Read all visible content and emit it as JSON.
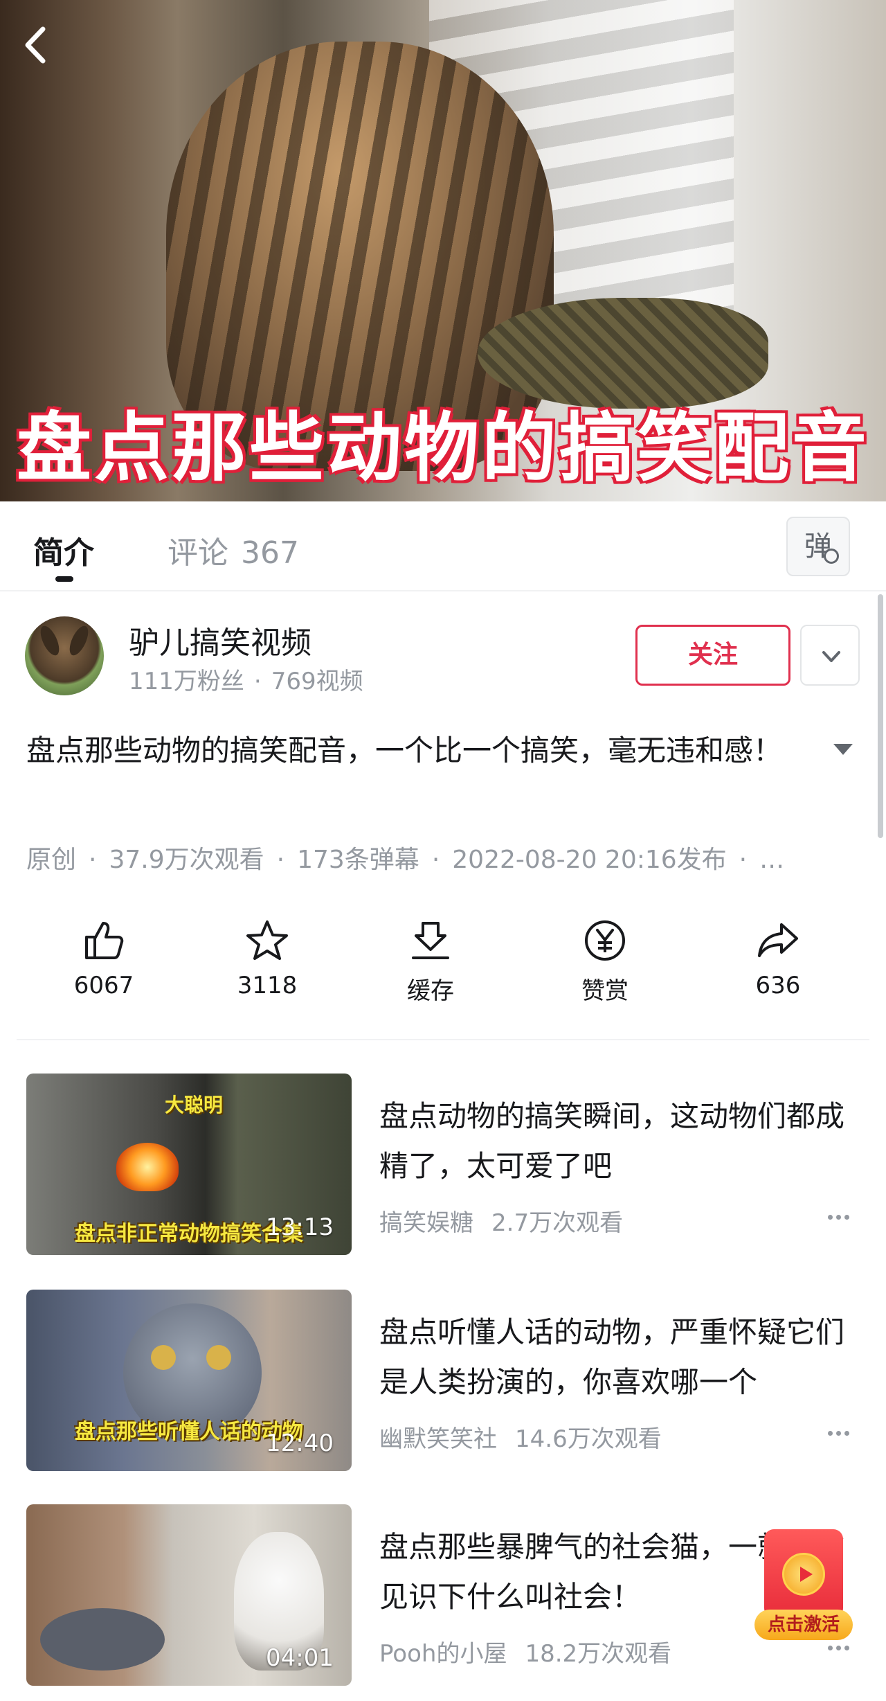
{
  "video": {
    "caption": "盘点那些动物的搞笑配音"
  },
  "tabs": {
    "intro": "简介",
    "comments_label": "评论",
    "comments_count": "367",
    "danmaku_toggle": "弹"
  },
  "uploader": {
    "name": "驴儿搞笑视频",
    "fans": "111万粉丝",
    "videos": "769视频",
    "follow_label": "关注"
  },
  "details": {
    "title": "盘点那些动物的搞笑配音，一个比一个搞笑，毫无违和感！",
    "meta": {
      "type": "原创",
      "views": "37.9万次观看",
      "danmaku": "173条弹幕",
      "published": "2022-08-20 20:16发布",
      "more": "…"
    }
  },
  "actions": [
    {
      "icon": "thumbs-up-icon",
      "label": "6067"
    },
    {
      "icon": "star-icon",
      "label": "3118"
    },
    {
      "icon": "download-icon",
      "label": "缓存"
    },
    {
      "icon": "yen-coin-icon",
      "label": "赞赏"
    },
    {
      "icon": "share-arrow-icon",
      "label": "636"
    }
  ],
  "recommended": [
    {
      "title": "盘点动物的搞笑瞬间，这动物们都成精了，太可爱了吧",
      "author": "搞笑娱糖",
      "views": "2.7万次观看",
      "duration": "13:13",
      "thumb_text": "盘点非正常动物搞笑合集",
      "thumb_tag": "大聪明"
    },
    {
      "title": "盘点听懂人话的动物，严重怀疑它们是人类扮演的，你喜欢哪一个",
      "author": "幽默笑笑社",
      "views": "14.6万次观看",
      "duration": "12:40",
      "thumb_text": "盘点那些听懂人话的动物"
    },
    {
      "title": "盘点那些暴脾气的社会猫，一就让你见识下什么叫社会！",
      "author": "Pooh的小屋",
      "views": "18.2万次观看",
      "duration": "04:01"
    }
  ],
  "floating_badge": {
    "label": "点击激活"
  },
  "colors": {
    "accent": "#e0304e",
    "text_primary": "#18191c",
    "text_secondary": "#9499a0"
  }
}
